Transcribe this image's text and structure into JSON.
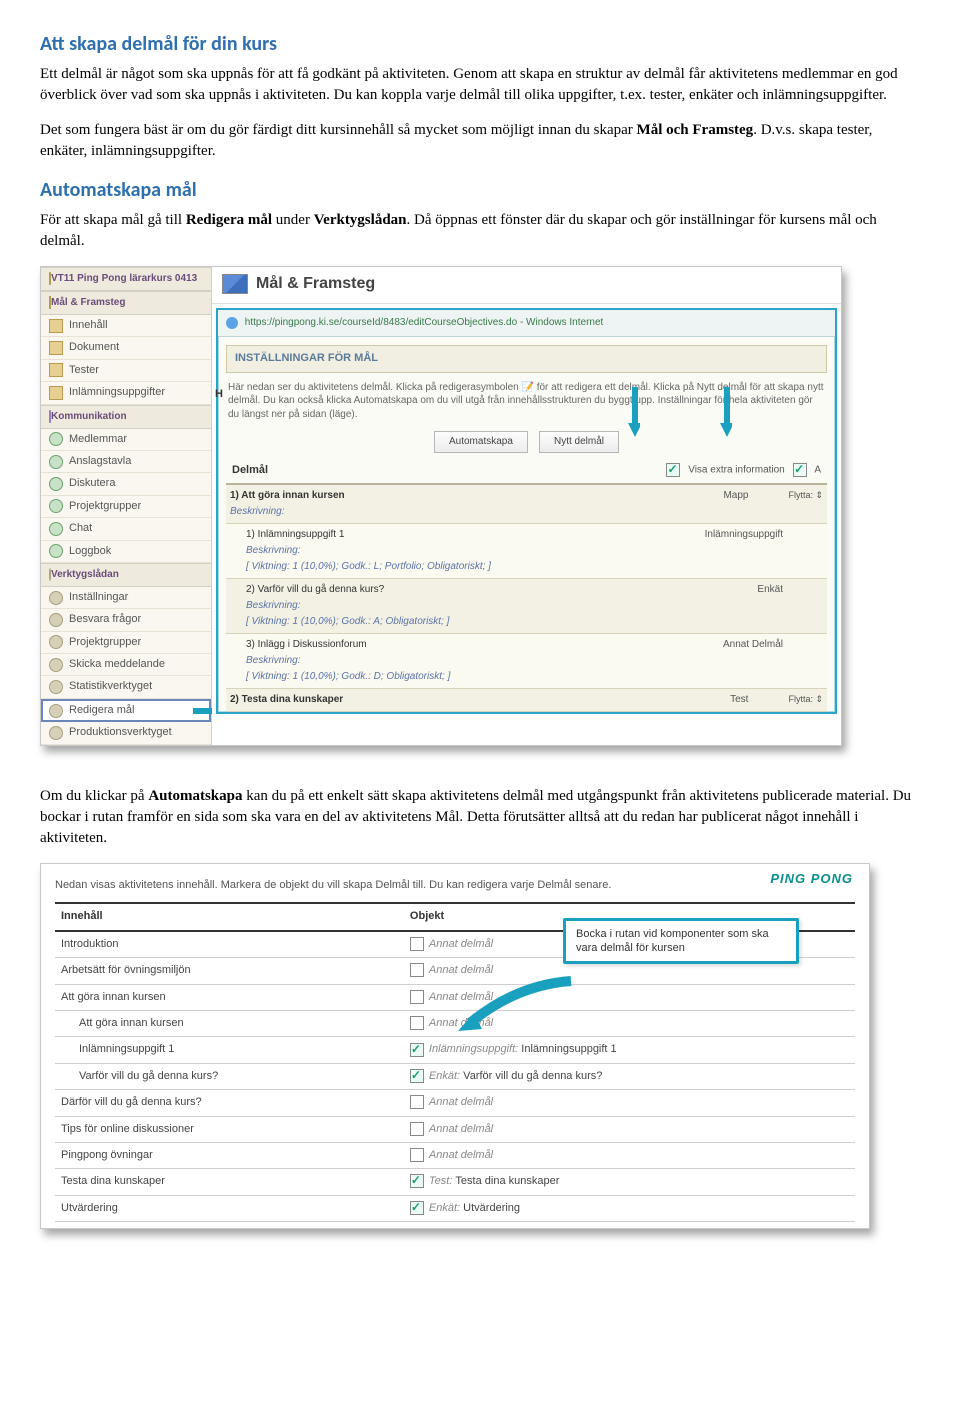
{
  "h1": "Att skapa delmål för din kurs",
  "p1": "Ett delmål är något som ska uppnås för att få godkänt på aktiviteten. Genom att skapa en struktur av delmål får aktivitetens medlemmar en god överblick över vad som ska uppnås i aktiviteten. Du kan koppla varje delmål till olika uppgifter, t.ex. tester, enkäter och inlämningsuppgifter.",
  "p2a": "Det som fungera bäst är om du gör färdigt ditt kursinnehåll så mycket som möjligt innan du skapar ",
  "p2b": "Mål och Framsteg",
  "p2c": ". D.v.s. skapa tester, enkäter, inlämningsuppgifter.",
  "h2": "Automatskapa mål",
  "p3a": "För att skapa mål gå till ",
  "p3b": "Redigera mål",
  "p3c": " under ",
  "p3d": "Verktygslådan",
  "p3e": ". Då öppnas ett fönster där du skapar och gör inställningar för kursens mål och delmål.",
  "p4a": "Om du klickar på ",
  "p4b": "Automatskapa",
  "p4c": " kan du på ett enkelt sätt skapa aktivitetens delmål med utgångspunkt från aktivitetens publicerade material. Du bockar i rutan framför en sida som ska vara en del av aktivitetens Mål. Detta förutsätter alltså att du redan har publicerat något innehåll i aktiviteten.",
  "shot1": {
    "course_header": "VT11 Ping Pong lärarkurs 0413",
    "groups": {
      "mal": {
        "title": "Mål & Framsteg",
        "items": [
          "Innehåll",
          "Dokument",
          "Tester",
          "Inlämningsuppgifter"
        ]
      },
      "komm": {
        "title": "Kommunikation",
        "items": [
          "Medlemmar",
          "Anslagstavla",
          "Diskutera",
          "Projektgrupper",
          "Chat",
          "Loggbok"
        ]
      },
      "vl": {
        "title": "Verktygslådan",
        "items": [
          "Inställningar",
          "Besvara frågor",
          "Projektgrupper",
          "Skicka meddelande",
          "Statistikverktyget",
          "Redigera mål",
          "Produktionsverktyget"
        ]
      }
    },
    "app_title": "Mål & Framsteg",
    "url": "https://pingpong.ki.se/courseId/8483/editCourseObjectives.do - Windows Internet",
    "section_head": "INSTÄLLNINGAR FÖR MÅL",
    "desc": "Här nedan ser du aktivitetens delmål. Klicka på redigerasymbolen 📝 för att redigera ett delmål. Klicka på Nytt delmål för att skapa nytt delmål. Du kan också klicka Automatskapa om du vill utgå från innehållsstrukturen du byggt upp. Inställningar för hela aktiviteten gör du längst ner på sidan (läge).",
    "btn1": "Automatskapa",
    "btn2": "Nytt delmål",
    "delmal": "Delmål",
    "vis_extra": "Visa extra information",
    "rows": [
      {
        "title": "1) Att göra innan kursen",
        "kind": "Mapp",
        "move": "Flytta: ⇕",
        "desc": "Beskrivning:"
      },
      {
        "sub": true,
        "title": "1) Inlämningsuppgift 1",
        "kind": "Inlämningsuppgift",
        "desc": "Beskrivning:",
        "meta": "[ Viktning: 1 (10,0%); Godk.: L; Portfolio; Obligatoriskt; ]"
      },
      {
        "sub": true,
        "title": "2) Varför vill du gå denna kurs?",
        "kind": "Enkät",
        "desc": "Beskrivning:",
        "meta": "[ Viktning: 1 (10,0%); Godk.: A; Obligatoriskt; ]"
      },
      {
        "sub": true,
        "title": "3) Inlägg i Diskussionforum",
        "kind": "Annat Delmål",
        "desc": "Beskrivning:",
        "meta": "[ Viktning: 1 (10,0%); Godk.: D; Obligatoriskt; ]"
      },
      {
        "title": "2) Testa dina kunskaper",
        "kind": "Test",
        "move": "Flytta: ⇕"
      }
    ]
  },
  "shot2": {
    "brand": "PING PONG",
    "desc": "Nedan visas aktivitetens innehåll. Markera de objekt du vill skapa Delmål till. Du kan redigera varje Delmål senare.",
    "th1": "Innehåll",
    "th2": "Objekt",
    "callout": "Bocka i rutan vid komponenter som ska vara delmål för kursen",
    "rows": [
      {
        "name": "Introduktion",
        "checked": false,
        "obj": "Annat delmål"
      },
      {
        "name": "Arbetsätt för övningsmiljön",
        "checked": false,
        "obj": "Annat delmål"
      },
      {
        "name": "Att göra innan kursen",
        "checked": false,
        "obj": "Annat delmål"
      },
      {
        "name": "Att göra innan kursen",
        "indent": true,
        "checked": false,
        "obj": "Annat delmål"
      },
      {
        "name": "Inlämningsuppgift 1",
        "indent": true,
        "checked": true,
        "obj": "Inlämningsuppgift: Inlämningsuppgift 1",
        "prefix": "Inlämningsuppgift:"
      },
      {
        "name": "Varför vill du gå denna kurs?",
        "indent": true,
        "checked": true,
        "obj": "Enkät: Varför vill du gå denna kurs?",
        "prefix": "Enkät:"
      },
      {
        "name": "Därför vill du gå denna kurs?",
        "checked": false,
        "obj": "Annat delmål"
      },
      {
        "name": "Tips för online diskussioner",
        "checked": false,
        "obj": "Annat delmål"
      },
      {
        "name": "Pingpong övningar",
        "checked": false,
        "obj": "Annat delmål"
      },
      {
        "name": "Testa dina kunskaper",
        "checked": true,
        "obj": "Test: Testa dina kunskaper",
        "prefix": "Test:"
      },
      {
        "name": "Utvärdering",
        "checked": true,
        "obj": "Enkät: Utvärdering",
        "prefix": "Enkät:"
      }
    ]
  }
}
